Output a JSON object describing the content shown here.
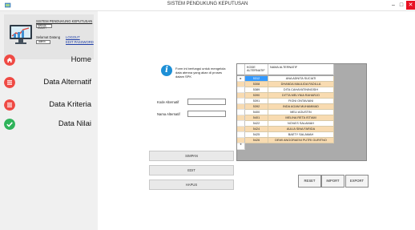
{
  "window": {
    "title": "SISTEM PENDUKUNG KEPUTUSAN",
    "min_glyph": "–",
    "max_glyph": "□",
    "close_glyph": "✕"
  },
  "user_panel": {
    "app_name": "SISTEM PENDUKUNG KEPUTUSAN",
    "method": "metode SMART",
    "welcome_label": "Selamat Datang",
    "username": "admin",
    "logout_label": "LOGOUT",
    "edit_password_label": "EDIT PASSWORD"
  },
  "nav": {
    "items": [
      {
        "label": "Home",
        "icon": "home-icon",
        "color": "#ef4a44"
      },
      {
        "label": "Data Alternatif",
        "icon": "list-icon",
        "color": "#ef4a44"
      },
      {
        "label": "Data Kriteria",
        "icon": "list-icon",
        "color": "#ef4a44"
      },
      {
        "label": "Data Nilai",
        "icon": "check-icon",
        "color": "#2fb35a"
      }
    ]
  },
  "form": {
    "info_glyph": "i",
    "info_text": "Form ini berfungsi untuk mengelola data atenna yang akan di proses dalam SPK",
    "kode_label": "Kode Alternatif",
    "kode_value": "",
    "nama_label": "Nama Alternatif",
    "nama_value": ""
  },
  "buttons": {
    "simpan": "SIMPAN",
    "edit": "EDIT",
    "hapus": "HAPUS",
    "reset": "RESET",
    "import": "IMPORT",
    "export": "EXPORT"
  },
  "table": {
    "headers": {
      "kode": "KODE ALTERNATIF",
      "nama": "NAMA ALTERNATIF"
    },
    "current_row_marker": "▸",
    "new_row_marker": "*",
    "rows": [
      {
        "kode": "5312",
        "nama": "ANA ADNITA SUCIATI"
      },
      {
        "kode": "5308",
        "nama": "DHANDA MAULIDA FADILLA"
      },
      {
        "kode": "5389",
        "nama": "DITA CAHAYATININGSIH"
      },
      {
        "kode": "5390",
        "nama": "DITTA MELYNIA RAHARJO"
      },
      {
        "kode": "5391",
        "nama": "FIGNI ONTAVIANI"
      },
      {
        "kode": "5392",
        "nama": "INDA AGAM MUHAMMAD"
      },
      {
        "kode": "5400",
        "nama": "MELI AGUSTIN"
      },
      {
        "kode": "5401",
        "nama": "MELINA RETA ISTIAM"
      },
      {
        "kode": "5422",
        "nama": "NOVA'S SALAMAH"
      },
      {
        "kode": "5424",
        "nama": "AULIA SINA FARIDA"
      },
      {
        "kode": "5425",
        "nama": "BAETY SALAMAH"
      },
      {
        "kode": "5426",
        "nama": "DEWI ANGGRAENI PUTRI GURITNO"
      }
    ],
    "selected_index": 0,
    "colors": {
      "selected": "#3399ff",
      "alt_row": "#f8dbb1",
      "empty_area": "#ababab"
    }
  }
}
